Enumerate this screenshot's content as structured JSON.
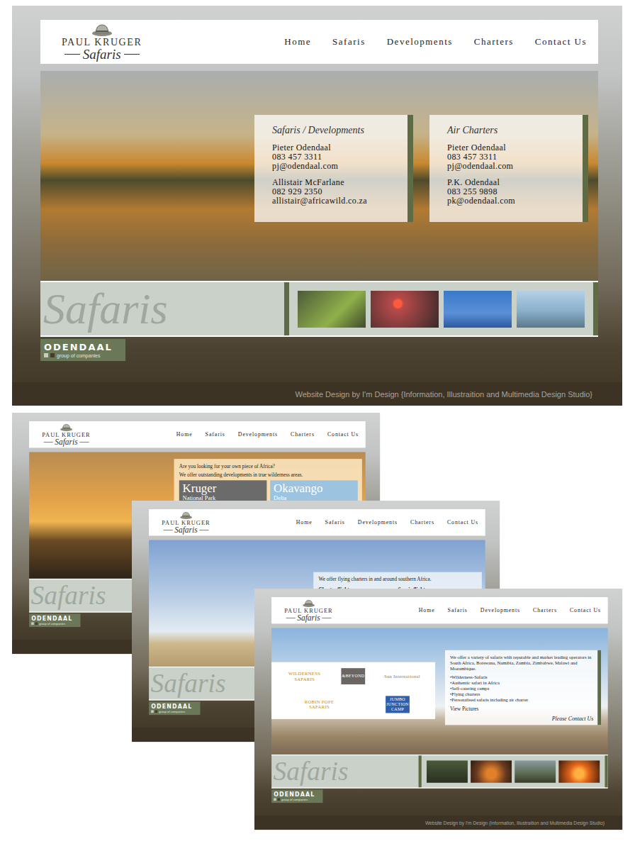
{
  "site": {
    "logo": {
      "name": "PAUL KRUGER",
      "script": "Safaris"
    },
    "nav": [
      "Home",
      "Safaris",
      "Developments",
      "Charters",
      "Contact Us"
    ],
    "watermark": "Safaris",
    "brand": {
      "name": "ODENDAAL",
      "tagline": "group of companies"
    }
  },
  "pages": [
    {
      "kind": "contacts",
      "credit": "Website Design by I'm Design {Information, Illustraition and Multimedia Design Studio}",
      "contacts": [
        {
          "title": "Safaris / Developments",
          "people": [
            {
              "name": "Pieter Odendaal",
              "phone": "083 457 3311",
              "email": "pj@odendaal.com"
            },
            {
              "name": "Allistair McFarlane",
              "phone": "082 929 2350",
              "email": "allistair@africawild.co.za"
            }
          ]
        },
        {
          "title": "Air Charters",
          "people": [
            {
              "name": "Pieter Odendaal",
              "phone": "083 457 3311",
              "email": "pj@odendaal.com"
            },
            {
              "name": "P.K. Odendaal",
              "phone": "083 255 9898",
              "email": "pk@odendaal.com"
            }
          ]
        }
      ]
    },
    {
      "kind": "developments",
      "credit": "",
      "intro": [
        "Are you looking for your own piece of Africa?",
        "We offer outstanding developments in true wilderness areas."
      ],
      "tiles": [
        {
          "title": "Kruger",
          "subtitle": "National Park",
          "color": "#6b6b6b"
        },
        {
          "title": "Okavango",
          "subtitle": "Delta",
          "color": "#9cc4e0"
        }
      ]
    },
    {
      "kind": "charters",
      "credit": "",
      "intro": [
        "We offer flying charters in and around southern Africa."
      ],
      "columns": [
        "Charter flights",
        "Scenic flights"
      ]
    },
    {
      "kind": "safaris",
      "credit": "Website Design by I'm Design (Information, Illustraition and Multimedia Design Studio)",
      "partners": [
        {
          "name": "WILDERNESS SAFARIS",
          "kind": "text",
          "color": "#b8861c"
        },
        {
          "name": "&BEYOND",
          "kind": "badge",
          "color": "#6b6661"
        },
        {
          "name": "Sun International",
          "kind": "text",
          "color": "#8c7d46"
        },
        {
          "name": "ROBIN POPE SAFARIS",
          "kind": "text",
          "color": "#c98c12"
        },
        {
          "name": "JUMBO JUNCTION CAMP",
          "kind": "badge",
          "color": "#2f5fa8"
        }
      ],
      "intro": [
        "We offer a variety of safaris with reputable and market leading operators in South Africa, Botswana, Namibia, Zambia, Zimbabwe, Malawi and Mozambique."
      ],
      "bullets": [
        "•Wilderness-Safaris",
        "•Authentic safari in Africa",
        "•Self-catering camps",
        "•Flying charters",
        "•Personalised safaris including air charter"
      ],
      "link": "View Pictures",
      "cta": "Please Contact Us"
    }
  ]
}
